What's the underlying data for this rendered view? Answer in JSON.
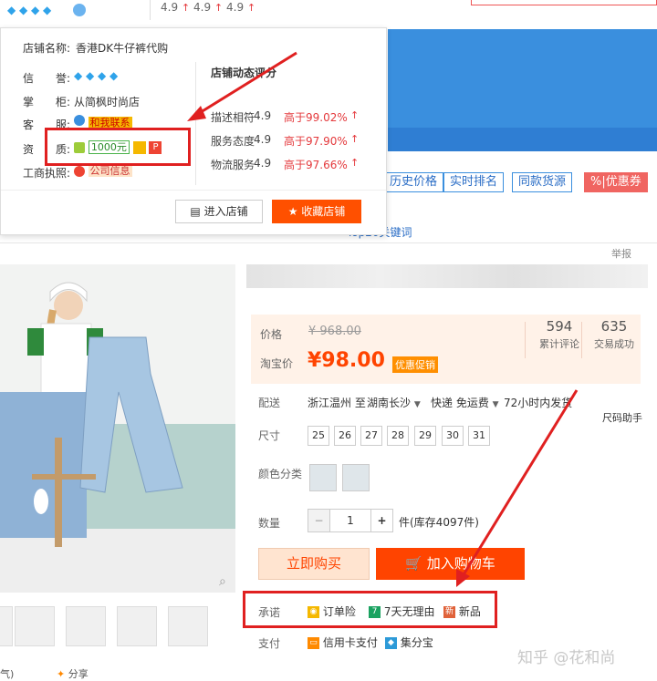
{
  "top": {
    "scores": [
      "4.9",
      "4.9",
      "4.9"
    ]
  },
  "popup": {
    "shop_name_label": "店铺名称:",
    "shop_name": "香港DK牛仔裤代购",
    "credit_label": "信　　誉:",
    "shopkeeper_label": "掌　　柜:",
    "shopkeeper": "从简枫时尚店",
    "cs_label": "客　　服:",
    "cs_link": "和我联系",
    "qual_label": "资　　质:",
    "deposit": "1000元",
    "license_label": "工商执照:",
    "license_link": "公司信息",
    "rating_title": "店铺动态评分",
    "ratings": [
      {
        "name": "描述相符",
        "score": "4.9",
        "pct": "高于99.02%"
      },
      {
        "name": "服务态度",
        "score": "4.9",
        "pct": "高于97.90%"
      },
      {
        "name": "物流服务",
        "score": "4.9",
        "pct": "高于97.66%"
      }
    ],
    "enter_store": "进入店铺",
    "fav_store": "收藏店铺"
  },
  "tools": [
    "历史价格",
    "实时排名",
    "同款货源",
    "%|优惠券"
  ],
  "tabs_hint": "Top20关键词",
  "report": "举报",
  "price": {
    "price_label": "价格",
    "original_price": "¥ 968.00",
    "taobao_label": "淘宝价",
    "current_price": "¥98.00",
    "promo": "优惠促销",
    "reviews_count": "594",
    "reviews_label": "累计评论",
    "deals_count": "635",
    "deals_label": "交易成功"
  },
  "delivery": {
    "label": "配送",
    "from": "浙江温州 至",
    "to": "湖南长沙",
    "method": "快递 免运费",
    "ship_time": "72小时内发货"
  },
  "size": {
    "label": "尺寸",
    "helper": "尺码助手",
    "options": [
      "25",
      "26",
      "27",
      "28",
      "29",
      "30",
      "31"
    ]
  },
  "color": {
    "label": "颜色分类"
  },
  "quantity": {
    "label": "数量",
    "minus": "−",
    "value": "1",
    "plus": "+",
    "stock": "件(库存4097件)"
  },
  "actions": {
    "buy_now": "立即购买",
    "add_cart": "加入购物车"
  },
  "promise": {
    "label": "承诺",
    "items": [
      "订单险",
      "7天无理由",
      "新品"
    ]
  },
  "payment": {
    "label": "支付",
    "items": [
      "信用卡支付",
      "集分宝"
    ]
  },
  "share": "分享",
  "bottom_left": "气)",
  "watermark": "知乎 @花和尚",
  "colors": {
    "accent": "#ff4400",
    "annotation": "#e02020",
    "link_blue": "#2a6dc6"
  }
}
